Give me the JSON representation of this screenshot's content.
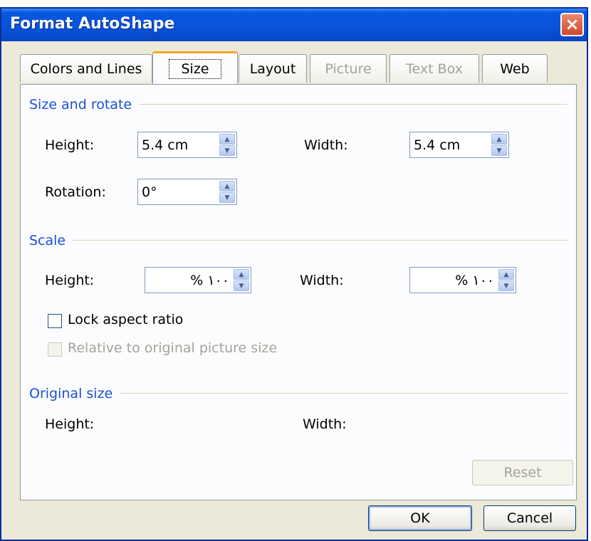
{
  "window": {
    "title": "Format AutoShape",
    "close_glyph": "×"
  },
  "tabs": [
    {
      "label": "Colors and Lines",
      "state": "normal"
    },
    {
      "label": "Size",
      "state": "active"
    },
    {
      "label": "Layout",
      "state": "normal"
    },
    {
      "label": "Picture",
      "state": "disabled"
    },
    {
      "label": "Text Box",
      "state": "disabled"
    },
    {
      "label": "Web",
      "state": "normal"
    }
  ],
  "size_rotate": {
    "title": "Size and rotate",
    "height_label": "Height:",
    "height_value": "5.4 cm",
    "width_label": "Width:",
    "width_value": "5.4 cm",
    "rotation_label": "Rotation:",
    "rotation_value": "0°"
  },
  "scale": {
    "title": "Scale",
    "height_label": "Height:",
    "height_value": "% ١٠٠",
    "width_label": "Width:",
    "width_value": "% ١٠٠",
    "lock_label": "Lock aspect ratio",
    "lock_checked": false,
    "relative_label": "Relative to original picture size",
    "relative_checked": false
  },
  "original": {
    "title": "Original size",
    "height_label": "Height:",
    "width_label": "Width:",
    "reset_label": "Reset"
  },
  "buttons": {
    "ok": "OK",
    "cancel": "Cancel"
  },
  "colors": {
    "title_bar": "#0a52d8",
    "section_title": "#1b4fd6",
    "dialog_bg": "#ece9d8",
    "active_tab_accent": "#f4a72f"
  },
  "icons": {
    "spin_up": "▲",
    "spin_down": "▼"
  }
}
